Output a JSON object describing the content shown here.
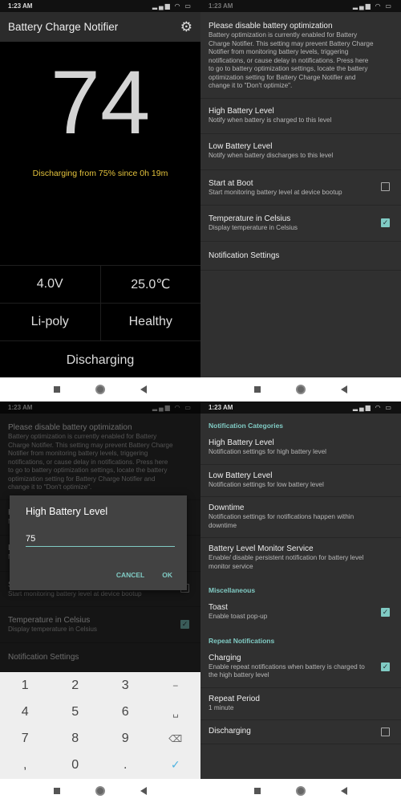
{
  "status": {
    "time": "1:23 AM",
    "icons": "signal-icon wifi-icon battery-icon"
  },
  "main_screen": {
    "title": "Battery Charge Notifier",
    "level": "74",
    "since": "Discharging from 75% since 0h 19m",
    "voltage": "4.0V",
    "temperature": "25.0℃",
    "technology": "Li-poly",
    "health": "Healthy",
    "state": "Discharging"
  },
  "settings": {
    "items": [
      {
        "title": "Please disable battery optimization",
        "summary": "Battery optimization is currently enabled for Battery Charge Notifier. This setting may prevent Battery Charge Notifier from monitoring battery levels, triggering notifications, or cause delay in notifications. Press here to go to battery optimization settings, locate the battery optimization setting for Battery Charge Notifier and change it to \"Don't optimize\"."
      },
      {
        "title": "High Battery Level",
        "summary": "Notify when battery is charged to this level"
      },
      {
        "title": "Low Battery Level",
        "summary": "Notify when battery discharges to this level"
      },
      {
        "title": "Start at Boot",
        "summary": "Start monitoring battery level at device bootup",
        "checkbox": false
      },
      {
        "title": "Temperature in Celsius",
        "summary": "Display temperature in Celsius",
        "checkbox": true
      },
      {
        "title": "Notification Settings"
      }
    ]
  },
  "dialog": {
    "title": "High Battery Level",
    "value": "75",
    "cancel": "CANCEL",
    "ok": "OK"
  },
  "keyboard": {
    "rows": [
      [
        "1",
        "2",
        "3",
        "−"
      ],
      [
        "4",
        "5",
        "6",
        "␣"
      ],
      [
        "7",
        "8",
        "9",
        "⌫"
      ],
      [
        ",",
        "0",
        ".",
        "✓"
      ]
    ]
  },
  "notification_settings": {
    "sections": [
      {
        "header": "Notification Categories",
        "items": [
          {
            "title": "High Battery Level",
            "summary": "Notification settings for high battery level"
          },
          {
            "title": "Low Battery Level",
            "summary": "Notification settings for low battery level"
          },
          {
            "title": "Downtime",
            "summary": "Notification settings for notifications happen within downtime"
          },
          {
            "title": "Battery Level Monitor Service",
            "summary": "Enable/ disable persistent notification for battery level monitor service"
          }
        ]
      },
      {
        "header": "Miscellaneous",
        "items": [
          {
            "title": "Toast",
            "summary": "Enable toast pop-up",
            "checkbox": true
          }
        ]
      },
      {
        "header": "Repeat Notifications",
        "items": [
          {
            "title": "Charging",
            "summary": "Enable repeat notifications when battery is charged to the high battery level",
            "checkbox": true
          },
          {
            "title": "Repeat Period",
            "summary": "1 minute"
          },
          {
            "title": "Discharging",
            "checkbox": false
          }
        ]
      }
    ]
  },
  "colors": {
    "accent": "#80cbc4",
    "since_text": "#e3c23c",
    "background": "#303030"
  }
}
